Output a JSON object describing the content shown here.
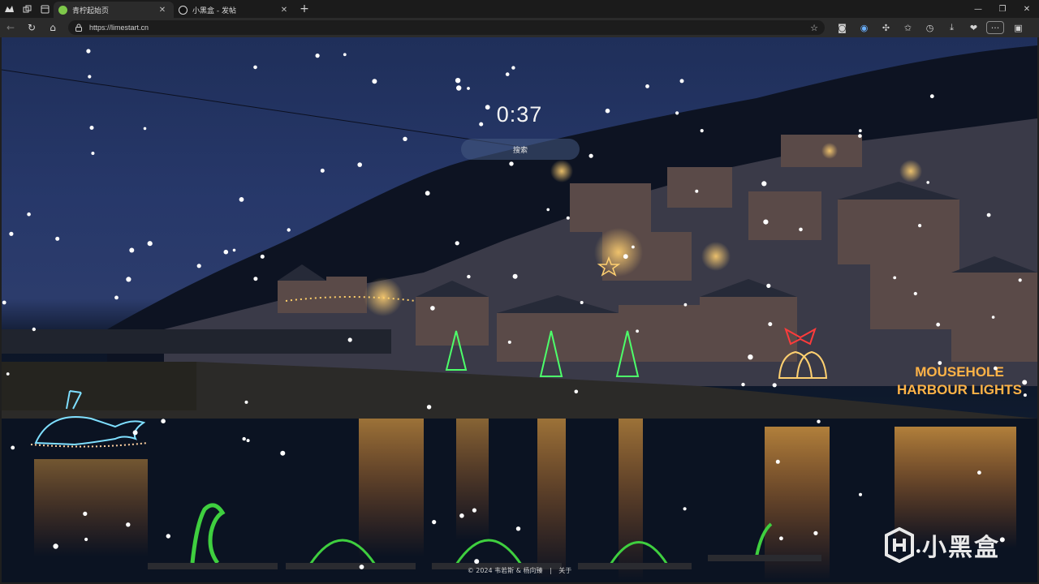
{
  "browser": {
    "tabs": [
      {
        "title": "青柠起始页",
        "active": true,
        "favicon_color": "#7ec84a"
      },
      {
        "title": "小黑盒 - 发帖",
        "active": false,
        "favicon_color": "#111111"
      }
    ],
    "new_tab_symbol": "+",
    "address": "https://limestart.cn"
  },
  "page": {
    "clock": "0:37",
    "search_label": "搜索",
    "footer": {
      "copyright": "© 2024 韦若斯 & 杨向臻",
      "separator": "|",
      "about": "关于"
    },
    "scene_sign_line1": "MOUSEHOLE",
    "scene_sign_line2": "HARBOUR LIGHTS"
  },
  "watermark": {
    "text": "小黑盒"
  },
  "colors": {
    "accent_tab": "#7ec84a",
    "sky_top": "#1f2f5a",
    "lights": "#ffb347",
    "tree_green": "#4dff6a",
    "bell_red": "#ff3b3b"
  }
}
